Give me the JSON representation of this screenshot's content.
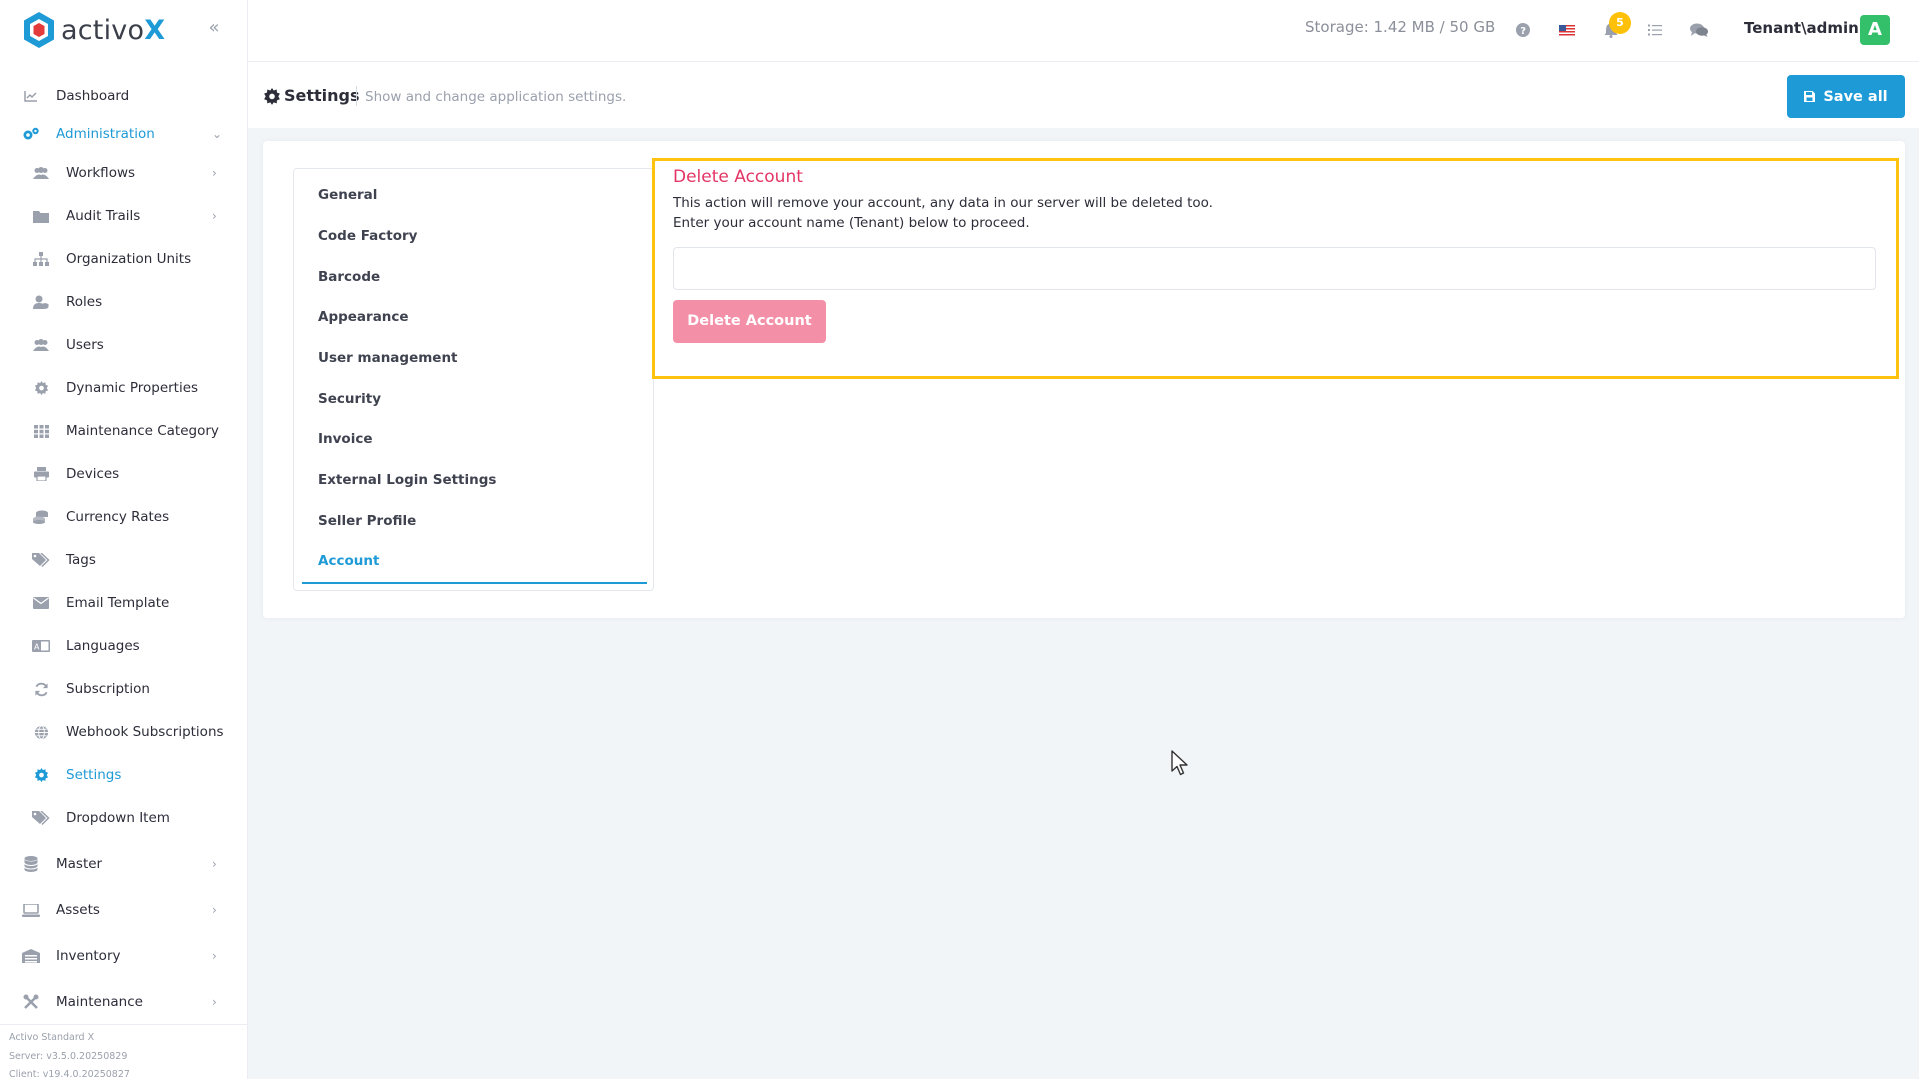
{
  "app": {
    "name_prefix": "activo",
    "name_suffix": "X"
  },
  "header": {
    "storage": "Storage: 1.42 MB / 50 GB",
    "notification_count": "5",
    "user": "Tenant\\admin",
    "avatar_letter": "A"
  },
  "sidebar": {
    "items": [
      {
        "label": "Dashboard"
      },
      {
        "label": "Administration"
      },
      {
        "label": "Workflows"
      },
      {
        "label": "Audit Trails"
      },
      {
        "label": "Organization Units"
      },
      {
        "label": "Roles"
      },
      {
        "label": "Users"
      },
      {
        "label": "Dynamic Properties"
      },
      {
        "label": "Maintenance Category"
      },
      {
        "label": "Devices"
      },
      {
        "label": "Currency Rates"
      },
      {
        "label": "Tags"
      },
      {
        "label": "Email Template"
      },
      {
        "label": "Languages"
      },
      {
        "label": "Subscription"
      },
      {
        "label": "Webhook Subscriptions"
      },
      {
        "label": "Settings"
      },
      {
        "label": "Dropdown Item"
      },
      {
        "label": "Master"
      },
      {
        "label": "Assets"
      },
      {
        "label": "Inventory"
      },
      {
        "label": "Maintenance"
      }
    ],
    "footer": {
      "edition": "Activo Standard X",
      "server": "Server: v3.5.0.20250829",
      "client": "Client: v19.4.0.20250827"
    }
  },
  "page": {
    "title": "Settings",
    "description": "Show and change application settings.",
    "save_label": "Save all"
  },
  "settings_tabs": [
    {
      "label": "General"
    },
    {
      "label": "Code Factory"
    },
    {
      "label": "Barcode"
    },
    {
      "label": "Appearance"
    },
    {
      "label": "User management"
    },
    {
      "label": "Security"
    },
    {
      "label": "Invoice"
    },
    {
      "label": "External Login Settings"
    },
    {
      "label": "Seller Profile"
    },
    {
      "label": "Account"
    }
  ],
  "delete_account": {
    "title": "Delete Account",
    "line1": "This action will remove your account, any data in our server will be deleted too.",
    "line2": "Enter your account name (Tenant) below to proceed.",
    "input_value": "",
    "button_label": "Delete Account"
  },
  "colors": {
    "accent": "#1e9ad6",
    "danger": "#e33565",
    "danger_button": "#f48fa8",
    "highlight_border": "#ffc20e",
    "avatar": "#34bf6b",
    "badge": "#ffc107"
  }
}
